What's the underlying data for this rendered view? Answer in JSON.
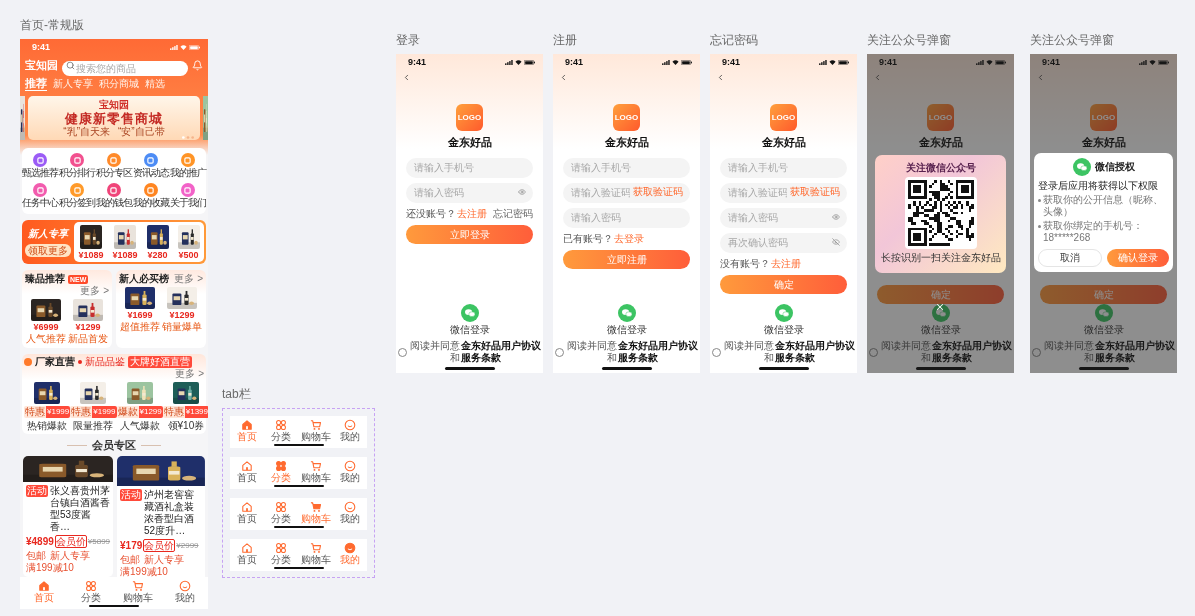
{
  "pages": [
    {
      "kind": "home",
      "label": "首页-常规版",
      "time": "9:41",
      "brand": "宝知园",
      "search_placeholder": "搜索您的商品",
      "tabs": [
        {
          "label": "推荐",
          "selected": true
        },
        {
          "label": "新人专享",
          "selected": false
        },
        {
          "label": "积分商城",
          "selected": false
        },
        {
          "label": "精选",
          "selected": false
        }
      ],
      "banner": {
        "title": "宝知园",
        "subtitle": "健康新零售商城",
        "slogans": [
          "“乳”自天来",
          "“安”自己带"
        ]
      },
      "shortcuts": [
        {
          "label": "甄选推荐",
          "color": "#9b5cf6"
        },
        {
          "label": "积分排行",
          "color": "#f2508f"
        },
        {
          "label": "积分专区",
          "color": "#ff8a2a"
        },
        {
          "label": "资讯动态",
          "color": "#4d8cf5"
        },
        {
          "label": "我的推广",
          "color": "#ff9426"
        },
        {
          "label": "任务中心",
          "color": "#f25cae"
        },
        {
          "label": "积分签到",
          "color": "#ff9a2a"
        },
        {
          "label": "我的钱包",
          "color": "#f0457a"
        },
        {
          "label": "我的收藏",
          "color": "#ff8622"
        },
        {
          "label": "关于我们",
          "color": "#f262c8"
        }
      ],
      "newcomer": {
        "title": "新人专享",
        "button": "领取更多",
        "prices": [
          "¥1089",
          "¥1089",
          "¥280",
          "¥500"
        ]
      },
      "cards": [
        {
          "title": "臻品推荐",
          "badge": "NEW",
          "more": "更多 >",
          "products": [
            {
              "price": "¥6999",
              "tag": "人气推荐"
            },
            {
              "price": "¥1299",
              "tag": "新品首发"
            }
          ]
        },
        {
          "title": "新人必买榜",
          "more": "更多 >",
          "products": [
            {
              "price": "¥1699",
              "tag": "超值推荐"
            },
            {
              "price": "¥1299",
              "tag": "销量爆单"
            }
          ]
        }
      ],
      "factory": {
        "title": "厂家直营",
        "note": "新品品鉴",
        "tag": "大牌好酒直营",
        "more": "更多 >",
        "products": [
          {
            "badge": "特惠",
            "price": "¥1999",
            "label": "热销爆款"
          },
          {
            "badge": "特惠",
            "price": "¥1999",
            "label": "限量推荐"
          },
          {
            "badge": "爆款",
            "price": "¥1299",
            "label": "人气爆款"
          },
          {
            "badge": "特惠",
            "price": "¥1399",
            "label": "领¥10券"
          }
        ]
      },
      "member_title": "会员专区",
      "goods": [
        {
          "tag": "活动",
          "title": "张义喜贵州茅台镇白酒酱香型53度酱香…",
          "price": "¥4899",
          "member_label": "会员价",
          "old_price": "¥5899",
          "labels": [
            "包邮",
            "新人专享",
            "满199减10"
          ]
        },
        {
          "tag": "活动",
          "title": "泸州老窖窖藏酒礼盒装浓香型白酒52度升…",
          "price": "¥179",
          "member_label": "会员价",
          "old_price": "¥2999",
          "labels": [
            "包邮",
            "新人专享",
            "满199减10"
          ]
        }
      ],
      "tab_bar": [
        {
          "label": "首页",
          "selected": true
        },
        {
          "label": "分类",
          "selected": false
        },
        {
          "label": "购物车",
          "selected": false
        },
        {
          "label": "我的",
          "selected": false
        }
      ]
    },
    {
      "kind": "auth",
      "label": "登录",
      "time": "9:41",
      "logo": "LOGO",
      "brand": "金东好品",
      "fields": [
        {
          "kind": "plain",
          "placeholder": "请输入手机号"
        },
        {
          "kind": "password",
          "placeholder": "请输入密码"
        }
      ],
      "prompt": {
        "text": "还没账号？",
        "link": "去注册"
      },
      "aside": "忘记密码",
      "button": "立即登录",
      "wechat_label": "微信登录",
      "agreement": {
        "checked": false,
        "parts": [
          {
            "text": "阅读并同意",
            "kind": "text"
          },
          {
            "text": "金东好品用户协议",
            "kind": "term"
          },
          {
            "text": "和",
            "kind": "text"
          },
          {
            "text": "服务条款",
            "kind": "term"
          }
        ]
      }
    },
    {
      "kind": "auth",
      "label": "注册",
      "time": "9:41",
      "logo": "LOGO",
      "brand": "金东好品",
      "fields": [
        {
          "kind": "plain",
          "placeholder": "请输入手机号"
        },
        {
          "kind": "code",
          "placeholder": "请输入验证码",
          "action": "获取验证码"
        },
        {
          "kind": "plain",
          "placeholder": "请输入密码"
        }
      ],
      "prompt": {
        "text": "已有账号？",
        "link": "去登录"
      },
      "button": "立即注册",
      "wechat_label": "微信登录",
      "agreement": {
        "checked": false,
        "parts": [
          {
            "text": "阅读并同意",
            "kind": "text"
          },
          {
            "text": "金东好品用户协议",
            "kind": "term"
          },
          {
            "text": "和",
            "kind": "text"
          },
          {
            "text": "服务条款",
            "kind": "term"
          }
        ]
      }
    },
    {
      "kind": "auth",
      "label": "忘记密码",
      "time": "9:41",
      "logo": "LOGO",
      "brand": "金东好品",
      "fields": [
        {
          "kind": "plain",
          "placeholder": "请输入手机号"
        },
        {
          "kind": "code",
          "placeholder": "请输入验证码",
          "action": "获取验证码"
        },
        {
          "kind": "password",
          "placeholder": "请输入密码"
        },
        {
          "kind": "confirm",
          "placeholder": "再次确认密码"
        }
      ],
      "prompt": {
        "text": "没有账号？",
        "link": "去注册"
      },
      "button": "确定",
      "wechat_label": "微信登录",
      "agreement": {
        "checked": false,
        "parts": [
          {
            "text": "阅读并同意",
            "kind": "text"
          },
          {
            "text": "金东好品用户协议",
            "kind": "term"
          },
          {
            "text": "和",
            "kind": "text"
          },
          {
            "text": "服务条款",
            "kind": "term"
          }
        ]
      }
    },
    {
      "kind": "popup",
      "label": "关注公众号弹窗",
      "time": "9:41",
      "logo": "LOGO",
      "brand": "金东好品",
      "button": "确定",
      "wechat_label": "微信登录",
      "agreement": {
        "checked": false,
        "parts": [
          {
            "text": "阅读并同意",
            "kind": "text"
          },
          {
            "text": "金东好品用户协议",
            "kind": "term"
          },
          {
            "text": "和",
            "kind": "text"
          },
          {
            "text": "服务条款",
            "kind": "term"
          }
        ]
      },
      "popup": {
        "kind": "qr",
        "title": "关注微信公众号",
        "caption": "长按识别一扫关注金东好品"
      }
    },
    {
      "kind": "popup",
      "label": "关注公众号弹窗",
      "time": "9:41",
      "logo": "LOGO",
      "brand": "金东好品",
      "button": "确定",
      "wechat_label": "微信登录",
      "agreement": {
        "checked": false,
        "parts": [
          {
            "text": "阅读并同意",
            "kind": "text"
          },
          {
            "text": "金东好品用户协议",
            "kind": "term"
          },
          {
            "text": "和",
            "kind": "text"
          },
          {
            "text": "服务条款",
            "kind": "term"
          }
        ]
      },
      "popup": {
        "kind": "authorize",
        "title": "微信授权",
        "intro": "登录后应用将获得以下权限",
        "permissions": [
          "获取你的公开信息（昵称、头像）",
          "获取你绑定的手机号：18*****268"
        ],
        "buttons": [
          {
            "label": "取消",
            "primary": false
          },
          {
            "label": "确认登录",
            "primary": true
          }
        ]
      }
    }
  ],
  "tab_bar_variants": {
    "label": "tab栏",
    "bars": [
      {
        "items": [
          {
            "label": "首页",
            "selected": true
          },
          {
            "label": "分类",
            "selected": false
          },
          {
            "label": "购物车",
            "selected": false
          },
          {
            "label": "我的",
            "selected": false
          }
        ]
      },
      {
        "items": [
          {
            "label": "首页",
            "selected": false
          },
          {
            "label": "分类",
            "selected": true
          },
          {
            "label": "购物车",
            "selected": false
          },
          {
            "label": "我的",
            "selected": false
          }
        ]
      },
      {
        "items": [
          {
            "label": "首页",
            "selected": false
          },
          {
            "label": "分类",
            "selected": false
          },
          {
            "label": "购物车",
            "selected": true
          },
          {
            "label": "我的",
            "selected": false
          }
        ]
      },
      {
        "items": [
          {
            "label": "首页",
            "selected": false
          },
          {
            "label": "分类",
            "selected": false
          },
          {
            "label": "购物车",
            "selected": false
          },
          {
            "label": "我的",
            "selected": true
          }
        ]
      }
    ]
  }
}
